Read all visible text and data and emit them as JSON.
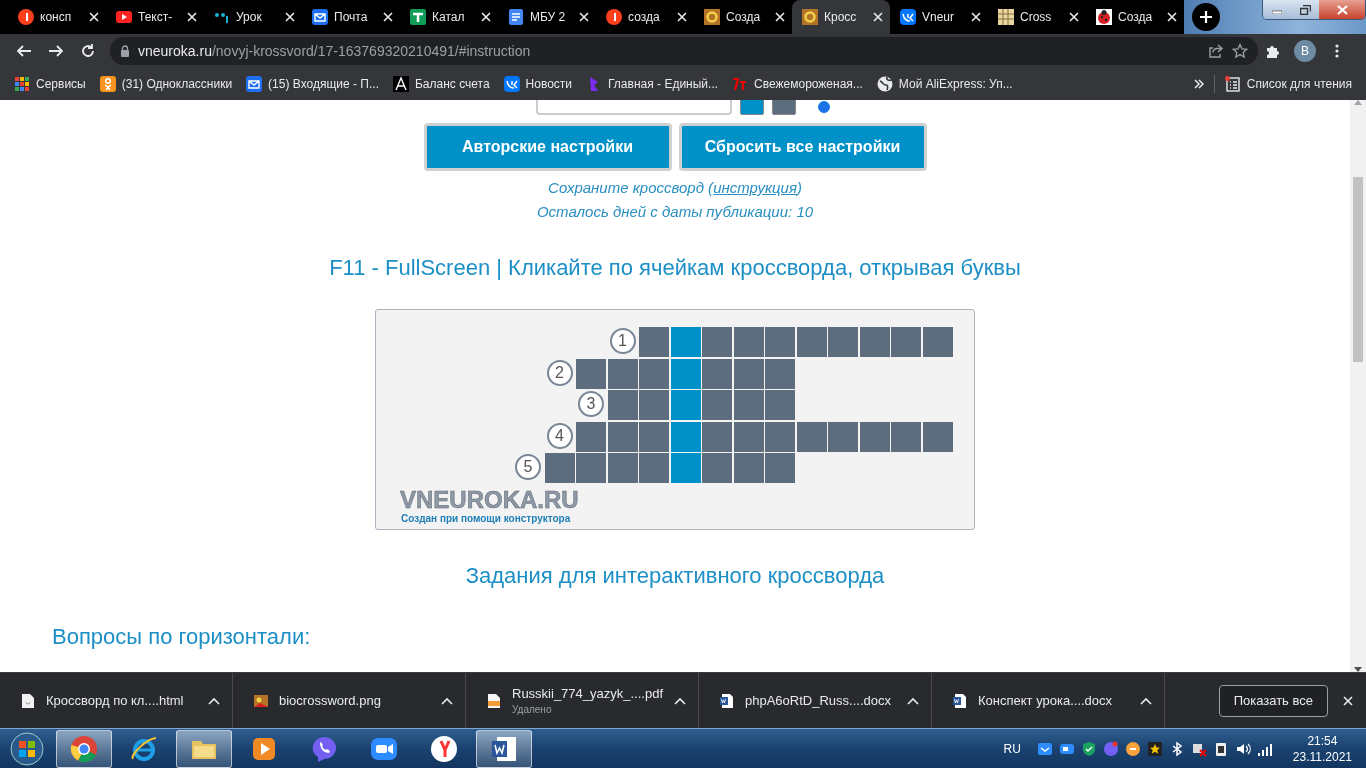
{
  "window": {
    "tabs": [
      {
        "title": "консп",
        "selected": false
      },
      {
        "title": "Текст-",
        "selected": false
      },
      {
        "title": "Урок",
        "selected": false
      },
      {
        "title": "Почта",
        "selected": false
      },
      {
        "title": "Катал",
        "selected": false
      },
      {
        "title": "МБУ 2",
        "selected": false
      },
      {
        "title": "созда",
        "selected": false
      },
      {
        "title": "Созда",
        "selected": false
      },
      {
        "title": "Кросс",
        "selected": true
      },
      {
        "title": "Vneur",
        "selected": false
      },
      {
        "title": "Cross",
        "selected": false
      },
      {
        "title": "Созда",
        "selected": false
      }
    ],
    "address_bar": {
      "domain": "vneuroka.ru",
      "path": "/novyj-krossvord/17-163769320210491/#instruction"
    },
    "profile": {
      "initial": "B"
    },
    "bookmarks": [
      {
        "label": "Сервисы"
      },
      {
        "label": "(31) Одноклассники"
      },
      {
        "label": "(15) Входящие - П..."
      },
      {
        "label": "Баланс счета"
      },
      {
        "label": "Новости"
      },
      {
        "label": "Главная - Единый..."
      },
      {
        "label": "Свежемороженая..."
      },
      {
        "label": "Мой AliExpress: Уп..."
      }
    ],
    "reading_list": {
      "label": "Список для чтения"
    }
  },
  "page": {
    "swatches": [
      {
        "color": "#0091c8"
      },
      {
        "color": "#5d6d7e"
      }
    ],
    "radio": {
      "selected": true
    },
    "buttons": [
      "Авторские настройки",
      "Сбросить все настройки"
    ],
    "save_note": {
      "before": "Сохраните кроссворд (",
      "link": "инструкция",
      "after": ")"
    },
    "days_left": "Осталось дней с даты публикации: 10",
    "instructions": "F11 - FullScreen | Кликайте по ячейкам кроссворда, открывая буквы",
    "crossword": {
      "rows": [
        {
          "number": "1",
          "cells": [
            {
              "kind": "empty"
            },
            {
              "kind": "empty"
            },
            {
              "kind": "empty"
            },
            {
              "kind": "letter",
              "highlighted": false
            },
            {
              "kind": "letter",
              "highlighted": true
            },
            {
              "kind": "letter",
              "highlighted": false
            },
            {
              "kind": "letter",
              "highlighted": false
            },
            {
              "kind": "letter",
              "highlighted": false
            },
            {
              "kind": "letter",
              "highlighted": false
            },
            {
              "kind": "letter",
              "highlighted": false
            },
            {
              "kind": "letter",
              "highlighted": false
            },
            {
              "kind": "letter",
              "highlighted": false
            },
            {
              "kind": "letter",
              "highlighted": false
            }
          ]
        },
        {
          "number": "2",
          "cells": [
            {
              "kind": "empty"
            },
            {
              "kind": "letter",
              "highlighted": false
            },
            {
              "kind": "letter",
              "highlighted": false
            },
            {
              "kind": "letter",
              "highlighted": false
            },
            {
              "kind": "letter",
              "highlighted": true
            },
            {
              "kind": "letter",
              "highlighted": false
            },
            {
              "kind": "letter",
              "highlighted": false
            },
            {
              "kind": "letter",
              "highlighted": false
            }
          ]
        },
        {
          "number": "3",
          "cells": [
            {
              "kind": "empty"
            },
            {
              "kind": "empty"
            },
            {
              "kind": "letter",
              "highlighted": false
            },
            {
              "kind": "letter",
              "highlighted": false
            },
            {
              "kind": "letter",
              "highlighted": true
            },
            {
              "kind": "letter",
              "highlighted": false
            },
            {
              "kind": "letter",
              "highlighted": false
            },
            {
              "kind": "letter",
              "highlighted": false
            }
          ]
        },
        {
          "number": "4",
          "cells": [
            {
              "kind": "empty"
            },
            {
              "kind": "letter",
              "highlighted": false
            },
            {
              "kind": "letter",
              "highlighted": false
            },
            {
              "kind": "letter",
              "highlighted": false
            },
            {
              "kind": "letter",
              "highlighted": true
            },
            {
              "kind": "letter",
              "highlighted": false
            },
            {
              "kind": "letter",
              "highlighted": false
            },
            {
              "kind": "letter",
              "highlighted": false
            },
            {
              "kind": "letter",
              "highlighted": false
            },
            {
              "kind": "letter",
              "highlighted": false
            },
            {
              "kind": "letter",
              "highlighted": false
            },
            {
              "kind": "letter",
              "highlighted": false
            },
            {
              "kind": "letter",
              "highlighted": false
            }
          ]
        },
        {
          "number": "5",
          "cells": [
            {
              "kind": "letter",
              "highlighted": false
            },
            {
              "kind": "letter",
              "highlighted": false
            },
            {
              "kind": "letter",
              "highlighted": false
            },
            {
              "kind": "letter",
              "highlighted": false
            },
            {
              "kind": "letter",
              "highlighted": true
            },
            {
              "kind": "letter",
              "highlighted": false
            },
            {
              "kind": "letter",
              "highlighted": false
            },
            {
              "kind": "letter",
              "highlighted": false
            }
          ]
        }
      ],
      "logo": "VNEUROKA.RU",
      "credit": "Создан при помощи конструктора"
    },
    "tasks_heading": "Задания для интерактивного кроссворда",
    "across_heading": "Вопросы по горизонтали:"
  },
  "downloads": {
    "items": [
      {
        "name": "Кроссворд по кл....html"
      },
      {
        "name": "biocrossword.png"
      },
      {
        "name": "Russkii_774_yazyk_....pdf",
        "status": "Удалено"
      },
      {
        "name": "phpA6oRtD_Russ....docx"
      },
      {
        "name": "Конспект урока....docx"
      }
    ],
    "show_all": "Показать все"
  },
  "taskbar": {
    "apps": [
      {
        "open": true
      },
      {
        "open": false
      },
      {
        "open": true
      },
      {
        "open": false
      },
      {
        "open": false
      },
      {
        "open": false
      },
      {
        "open": false
      },
      {
        "open": true
      }
    ],
    "language": "RU",
    "time": "21:54",
    "date": "23.11.2021"
  }
}
